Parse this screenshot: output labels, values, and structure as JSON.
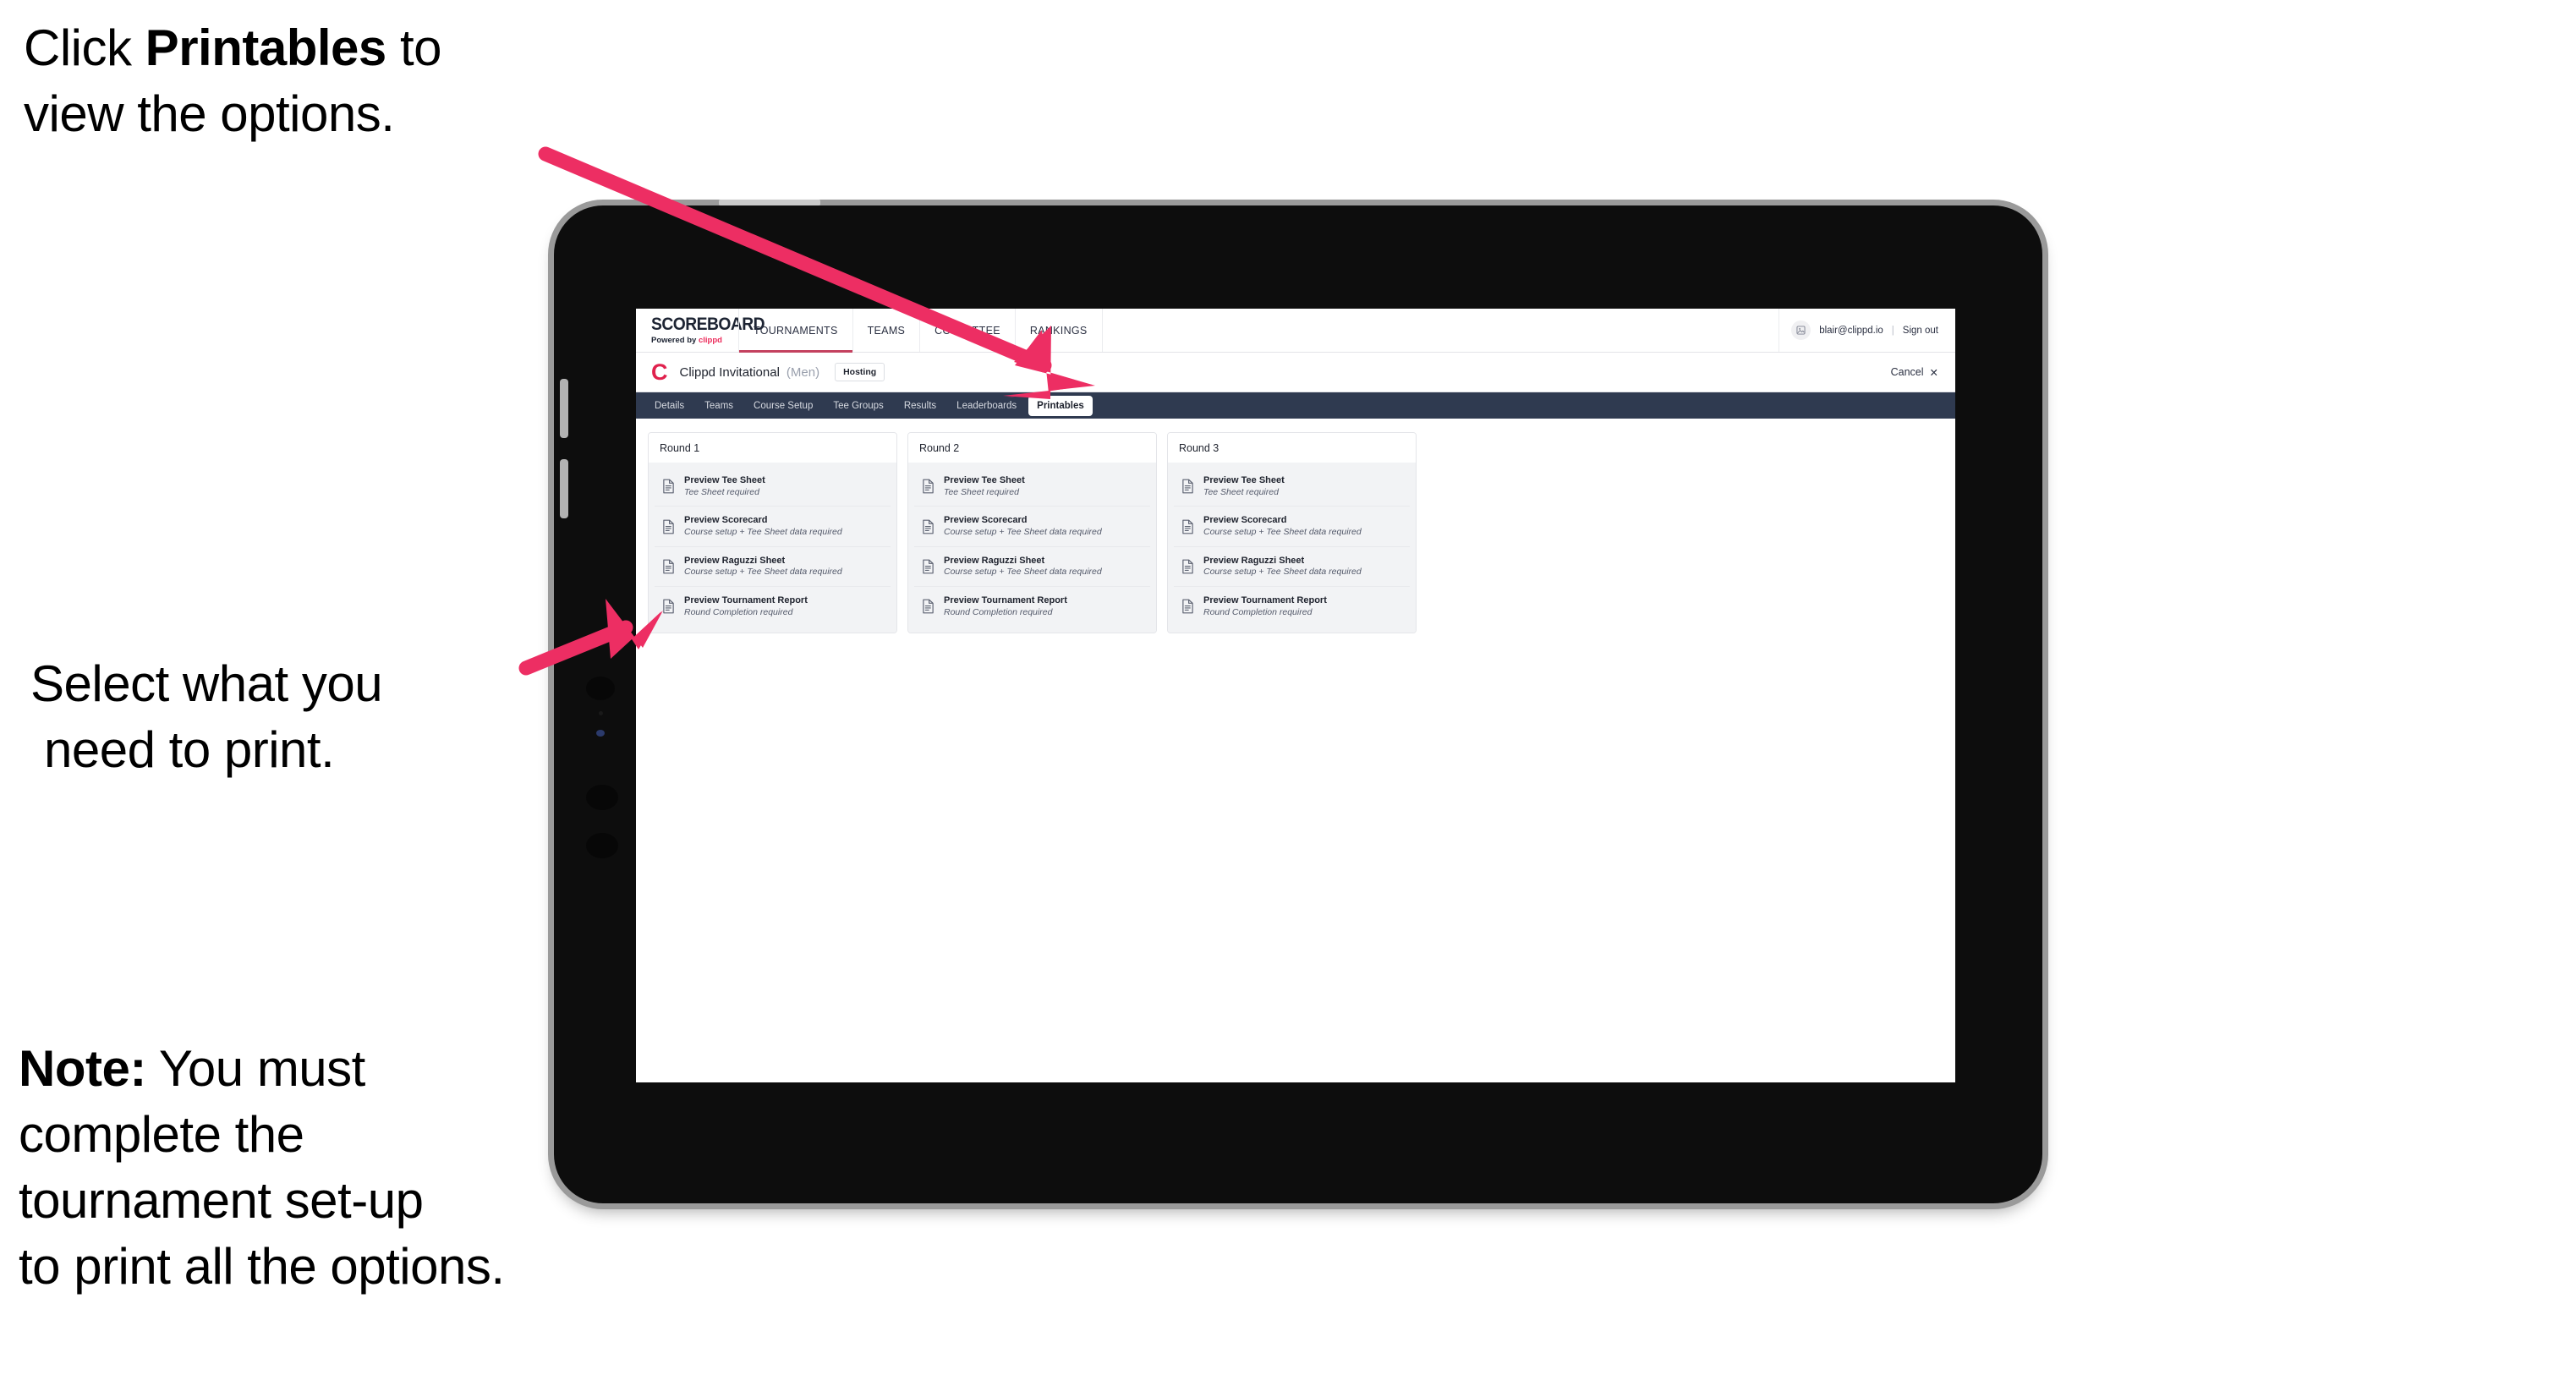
{
  "annotations": {
    "top": {
      "pre": "Click ",
      "bold": "Printables",
      "post": " to",
      "line2": "view the options."
    },
    "middle": {
      "line1": "Select what you",
      "line2": "need to print."
    },
    "note": {
      "bold": "Note:",
      "rest": " You must",
      "line2": "complete the",
      "line3": "tournament set-up",
      "line4": "to print all the options."
    }
  },
  "app": {
    "brand": {
      "wordmark": "SCOREBOARD",
      "powered_prefix": "Powered by ",
      "powered_brand": "clippd"
    },
    "global_nav": [
      {
        "label": "TOURNAMENTS",
        "active": true
      },
      {
        "label": "TEAMS",
        "active": false
      },
      {
        "label": "COMMITTEE",
        "active": false
      },
      {
        "label": "RANKINGS",
        "active": false
      }
    ],
    "user": {
      "avatar_glyph": "⛶",
      "email": "blair@clippd.io",
      "separator": "|",
      "sign_out": "Sign out"
    },
    "title_bar": {
      "logo_letter": "C",
      "tournament": "Clippd Invitational",
      "gender": "(Men)",
      "role_chip": "Hosting",
      "cancel": "Cancel",
      "cancel_icon": "✕"
    },
    "sub_tabs": [
      {
        "label": "Details",
        "active": false
      },
      {
        "label": "Teams",
        "active": false
      },
      {
        "label": "Course Setup",
        "active": false
      },
      {
        "label": "Tee Groups",
        "active": false
      },
      {
        "label": "Results",
        "active": false
      },
      {
        "label": "Leaderboards",
        "active": false
      },
      {
        "label": "Printables",
        "active": true
      }
    ],
    "rounds": [
      {
        "title": "Round 1",
        "items": [
          {
            "title": "Preview Tee Sheet",
            "requirement": "Tee Sheet required"
          },
          {
            "title": "Preview Scorecard",
            "requirement": "Course setup + Tee Sheet data required"
          },
          {
            "title": "Preview Raguzzi Sheet",
            "requirement": "Course setup + Tee Sheet data required"
          },
          {
            "title": "Preview Tournament Report",
            "requirement": "Round Completion required"
          }
        ]
      },
      {
        "title": "Round 2",
        "items": [
          {
            "title": "Preview Tee Sheet",
            "requirement": "Tee Sheet required"
          },
          {
            "title": "Preview Scorecard",
            "requirement": "Course setup + Tee Sheet data required"
          },
          {
            "title": "Preview Raguzzi Sheet",
            "requirement": "Course setup + Tee Sheet data required"
          },
          {
            "title": "Preview Tournament Report",
            "requirement": "Round Completion required"
          }
        ]
      },
      {
        "title": "Round 3",
        "items": [
          {
            "title": "Preview Tee Sheet",
            "requirement": "Tee Sheet required"
          },
          {
            "title": "Preview Scorecard",
            "requirement": "Course setup + Tee Sheet data required"
          },
          {
            "title": "Preview Raguzzi Sheet",
            "requirement": "Course setup + Tee Sheet data required"
          },
          {
            "title": "Preview Tournament Report",
            "requirement": "Round Completion required"
          }
        ]
      }
    ]
  },
  "colors": {
    "arrow_pink": "#ED2E63",
    "accent_red": "#E0214D",
    "subtab_bar": "#2F3A50",
    "active_underline": "#C4415F",
    "bezel": "#0D0D0D"
  }
}
